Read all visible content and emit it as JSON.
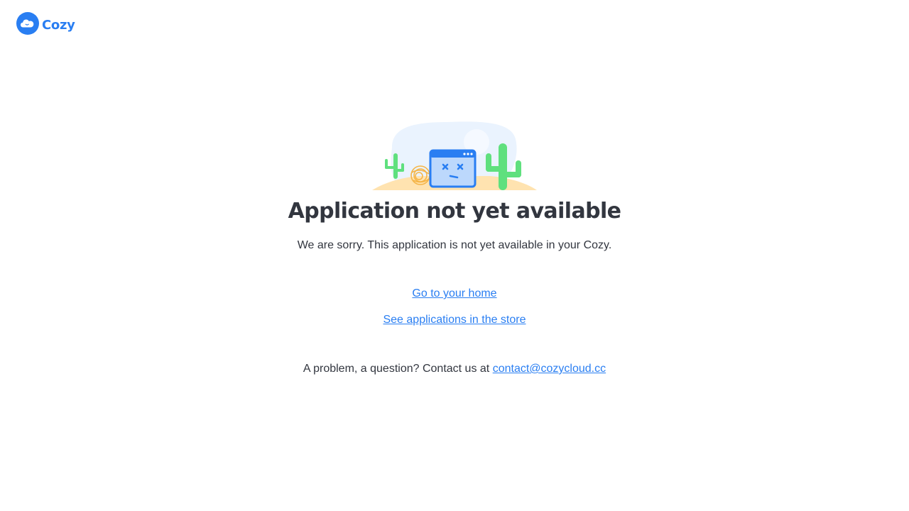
{
  "brand": {
    "name": "Cozy",
    "color": "#297ef2"
  },
  "illustration": {
    "icon": "broken-app-desert-icon"
  },
  "error": {
    "title": "Application not yet available",
    "message": "We are sorry. This application is not yet available in your Cozy."
  },
  "links": {
    "home": "Go to your home",
    "store": "See applications in the store"
  },
  "contact": {
    "prefix": "A problem, a question? Contact us at",
    "email": "contact@cozycloud.cc"
  },
  "colors": {
    "text": "#32363f",
    "link": "#297ef2",
    "cactus": "#5fe07e",
    "sand": "#ffe3b0",
    "sky": "#eaf3fe"
  }
}
